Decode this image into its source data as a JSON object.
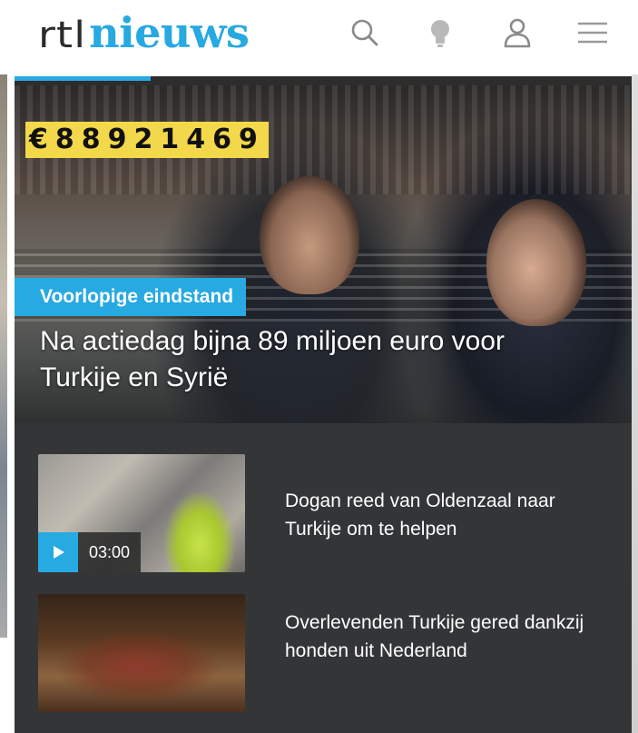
{
  "header": {
    "logo_rtl": "rtl",
    "logo_nieuws": "nieuws",
    "icons": [
      "search-icon",
      "bulb-icon",
      "user-icon",
      "menu-icon"
    ]
  },
  "hero": {
    "counter": "€88921469",
    "badge": "Voorlopige eindstand",
    "title": "Na actiedag bijna 89 miljoen euro voor Turkije en Syrië"
  },
  "articles": [
    {
      "title": "Dogan reed van Oldenzaal naar Turkije om te helpen",
      "video_duration": "03:00"
    },
    {
      "title": "Overlevenden Turkije gered dankzij honden uit Nederland"
    }
  ],
  "colors": {
    "brand_blue": "#27a9e1",
    "list_bg": "#333537",
    "counter_yellow": "#f2d84a"
  }
}
